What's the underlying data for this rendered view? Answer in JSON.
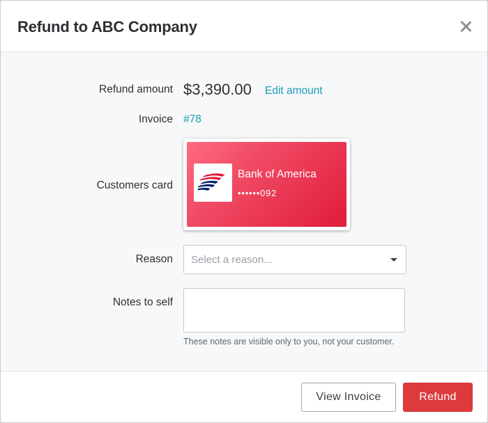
{
  "modal": {
    "title": "Refund to ABC Company"
  },
  "form": {
    "refund_amount": {
      "label": "Refund amount",
      "value": "$3,390.00",
      "edit_label": "Edit amount"
    },
    "invoice": {
      "label": "Invoice",
      "value": "#78"
    },
    "customer_card": {
      "label": "Customers card",
      "bank_name": "Bank of America",
      "number": "••••••092",
      "logo_icon": "bank-of-america-logo",
      "card_color": "#e8213f"
    },
    "reason": {
      "label": "Reason",
      "placeholder": "Select a reason..."
    },
    "notes": {
      "label": "Notes to self",
      "value": "",
      "helper": "These notes are visible only to you, not your customer."
    }
  },
  "footer": {
    "view_invoice_label": "View Invoice",
    "refund_label": "Refund"
  },
  "colors": {
    "accent_link": "#1a9bb6",
    "primary_button": "#dc3a3d"
  }
}
